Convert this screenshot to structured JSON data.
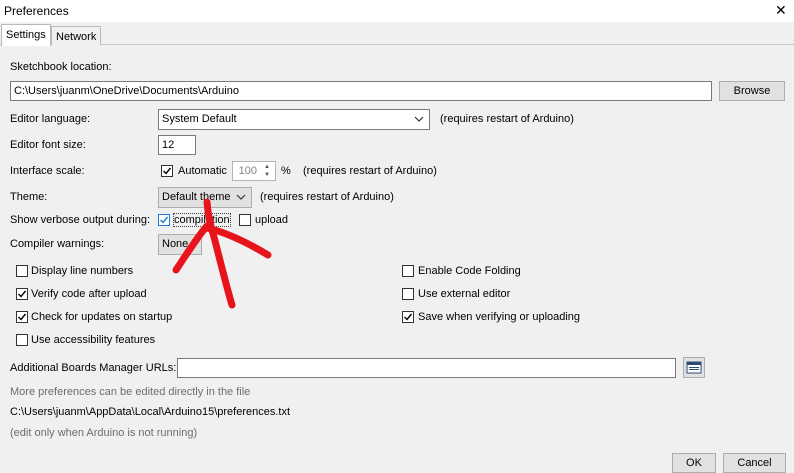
{
  "window": {
    "title": "Preferences",
    "close_glyph": "✕"
  },
  "tabs": [
    {
      "label": "Settings"
    },
    {
      "label": "Network"
    }
  ],
  "sketchbook": {
    "label": "Sketchbook location:",
    "value": "C:\\Users\\juanm\\OneDrive\\Documents\\Arduino",
    "browse_label": "Browse"
  },
  "editor_language": {
    "label": "Editor language:",
    "value": "System Default",
    "note": "(requires restart of Arduino)"
  },
  "font_size": {
    "label": "Editor font size:",
    "value": "12"
  },
  "interface_scale": {
    "label": "Interface scale:",
    "automatic_label": "Automatic",
    "automatic_checked": true,
    "value": "100",
    "unit": "%",
    "note": "(requires restart of Arduino)"
  },
  "theme": {
    "label": "Theme:",
    "value": "Default theme",
    "note": "(requires restart of Arduino)"
  },
  "verbose": {
    "label": "Show verbose output during:",
    "compilation_label": "compilation",
    "compilation_checked": true,
    "upload_label": "upload",
    "upload_checked": false
  },
  "compiler_warnings": {
    "label": "Compiler warnings:",
    "value": "None"
  },
  "options_left": [
    {
      "label": "Display line numbers",
      "checked": false
    },
    {
      "label": "Verify code after upload",
      "checked": true
    },
    {
      "label": "Check for updates on startup",
      "checked": true
    },
    {
      "label": "Use accessibility features",
      "checked": false
    }
  ],
  "options_right": [
    {
      "label": "Enable Code Folding",
      "checked": false
    },
    {
      "label": "Use external editor",
      "checked": false
    },
    {
      "label": "Save when verifying or uploading",
      "checked": true
    }
  ],
  "boards_urls": {
    "label": "Additional Boards Manager URLs:",
    "value": "",
    "button_icon": "window-list-icon"
  },
  "info": {
    "more_prefs": "More preferences can be edited directly in the file",
    "path": "C:\\Users\\juanm\\AppData\\Local\\Arduino15\\preferences.txt",
    "edit_note": "(edit only when Arduino is not running)"
  },
  "footer": {
    "ok_label": "OK",
    "cancel_label": "Cancel"
  },
  "annotation": {
    "color": "#e8141c"
  },
  "colors": {
    "checkbox_focus": "#1e78d7"
  }
}
